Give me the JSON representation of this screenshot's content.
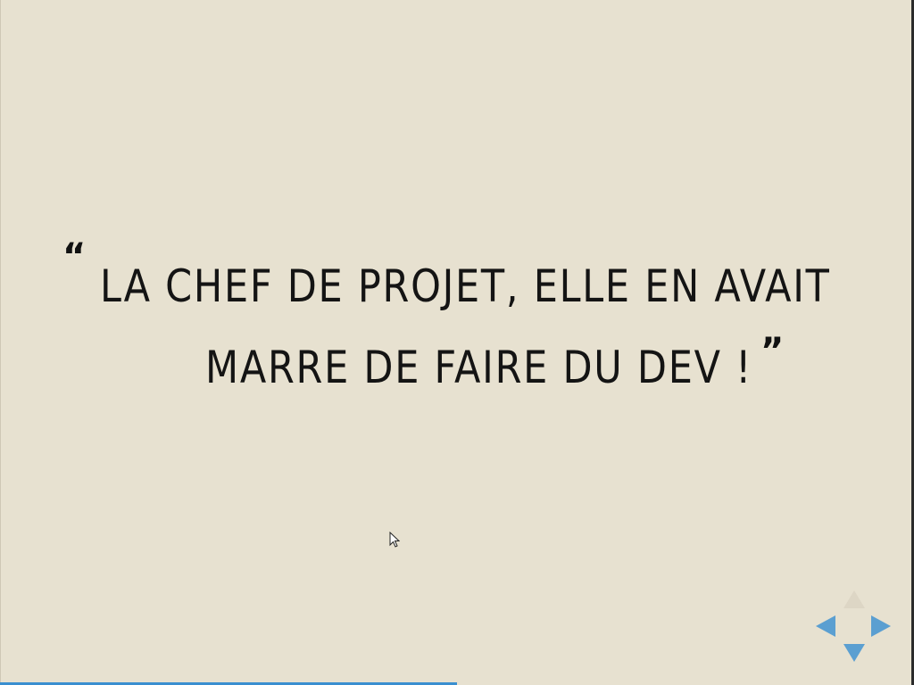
{
  "slide": {
    "quote": {
      "open_mark": "“",
      "line1": "LA CHEF DE PROJET, ELLE EN AVAIT",
      "line2": "MARRE DE FAIRE DU DEV !",
      "close_mark": "”"
    }
  },
  "navigation": {
    "up_icon": "arrow-up-icon",
    "left_icon": "arrow-left-icon",
    "right_icon": "arrow-right-icon",
    "down_icon": "arrow-down-icon",
    "up_enabled": false,
    "accent_color": "#5b9fd1"
  },
  "progress": {
    "fraction": 0.5,
    "color": "#3a8fd0"
  },
  "colors": {
    "background": "#e7e1d0",
    "text": "#141414"
  }
}
